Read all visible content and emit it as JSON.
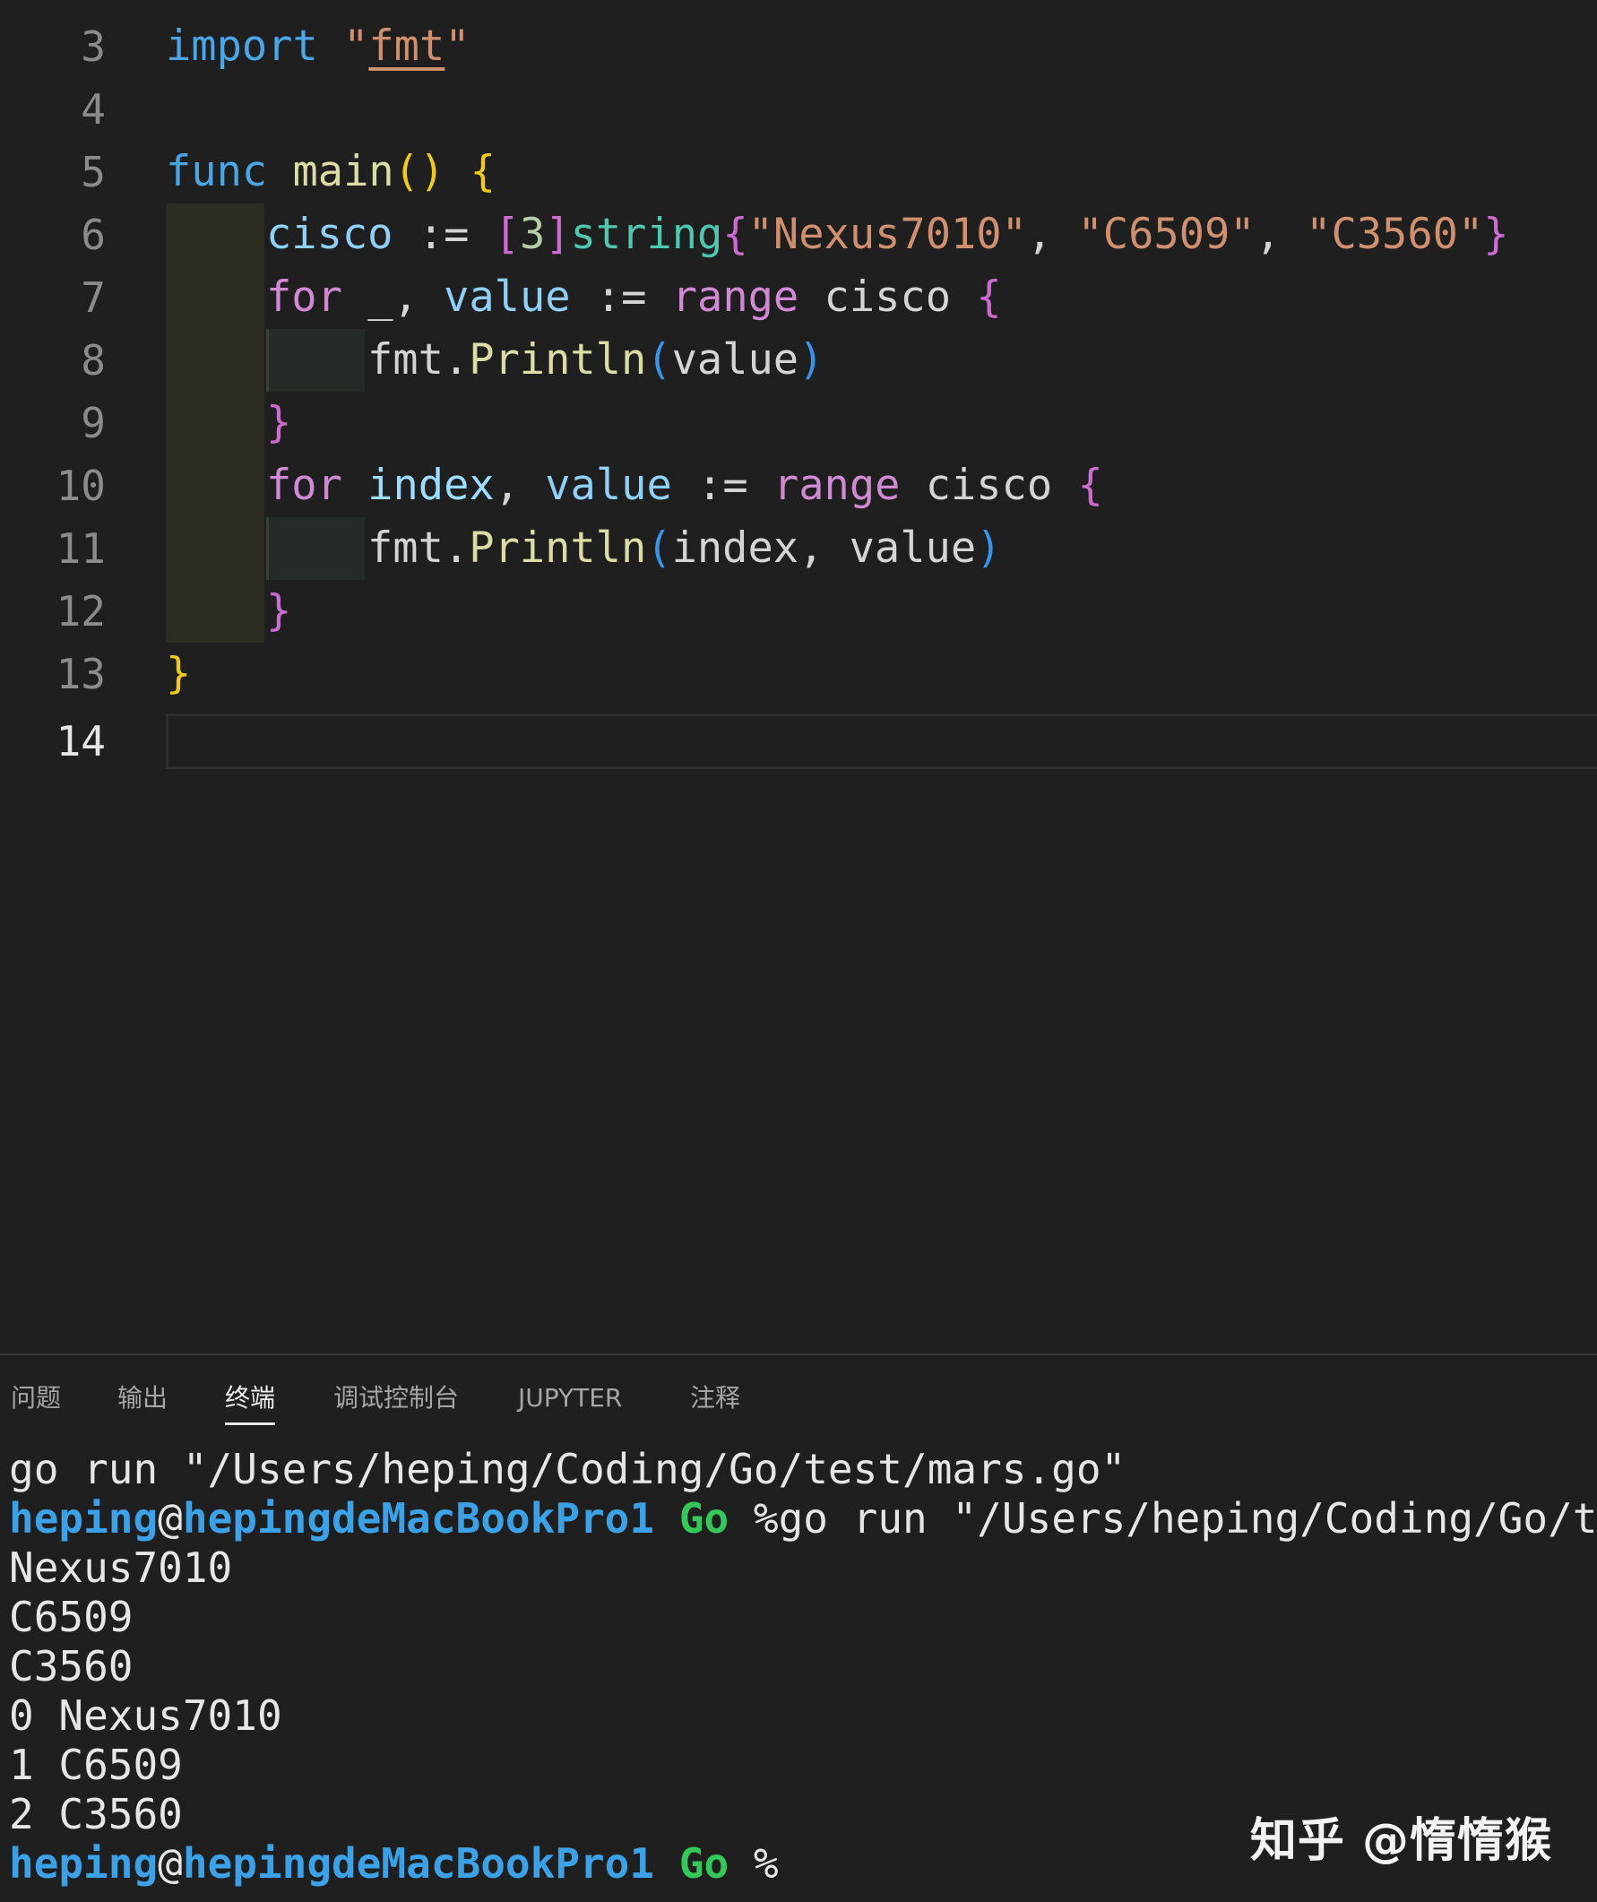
{
  "editor": {
    "line_numbers": [
      "3",
      "4",
      "5",
      "6",
      "7",
      "8",
      "9",
      "10",
      "11",
      "12",
      "13",
      "14"
    ],
    "active_line": "14",
    "code": {
      "l3": {
        "kw": "import",
        "str_q1": "\"",
        "str": "fmt",
        "str_q2": "\""
      },
      "l5": {
        "kw": "func",
        "name": "main",
        "paren": "()",
        "brace": "{"
      },
      "l6": {
        "var": "cisco",
        "op": ":=",
        "lb": "[",
        "num": "3",
        "rb": "]",
        "type": "string",
        "brace_open": "{",
        "s1": "\"Nexus7010\"",
        "comma1": ",",
        "s2": "\"C6509\"",
        "comma2": ",",
        "s3": "\"C3560\"",
        "brace_close": "}"
      },
      "l7": {
        "kw": "for",
        "blank": "_,",
        "var": "value",
        "op": ":=",
        "range": "range",
        "iter": "cisco",
        "brace": "{"
      },
      "l8": {
        "pkg": "fmt.",
        "fn": "Println",
        "lp": "(",
        "arg": "value",
        "rp": ")"
      },
      "l9": {
        "brace": "}"
      },
      "l10": {
        "kw": "for",
        "var1": "index",
        "comma": ",",
        "var2": "value",
        "op": ":=",
        "range": "range",
        "iter": "cisco",
        "brace": "{"
      },
      "l11": {
        "pkg": "fmt.",
        "fn": "Println",
        "lp": "(",
        "args": "index, value",
        "rp": ")"
      },
      "l12": {
        "brace": "}"
      },
      "l13": {
        "brace": "}"
      }
    }
  },
  "panel": {
    "tabs": [
      "问题",
      "输出",
      "终端",
      "调试控制台",
      "JUPYTER",
      "注释"
    ],
    "active_tab": "终端",
    "terminal": {
      "line1": "go run \"/Users/heping/Coding/Go/test/mars.go\"",
      "prompt_user": "heping",
      "prompt_at": "@",
      "prompt_host": "hepingdeMacBookPro1",
      "prompt_dir": "Go",
      "prompt_cmd": "%go run \"/Users/heping/Coding/Go/te",
      "output": [
        "Nexus7010",
        "C6509",
        "C3560",
        "0 Nexus7010",
        "1 C6509",
        "2 C3560"
      ],
      "final_prompt_symbol": "%"
    }
  },
  "watermark": "知乎 @惰惰猴"
}
